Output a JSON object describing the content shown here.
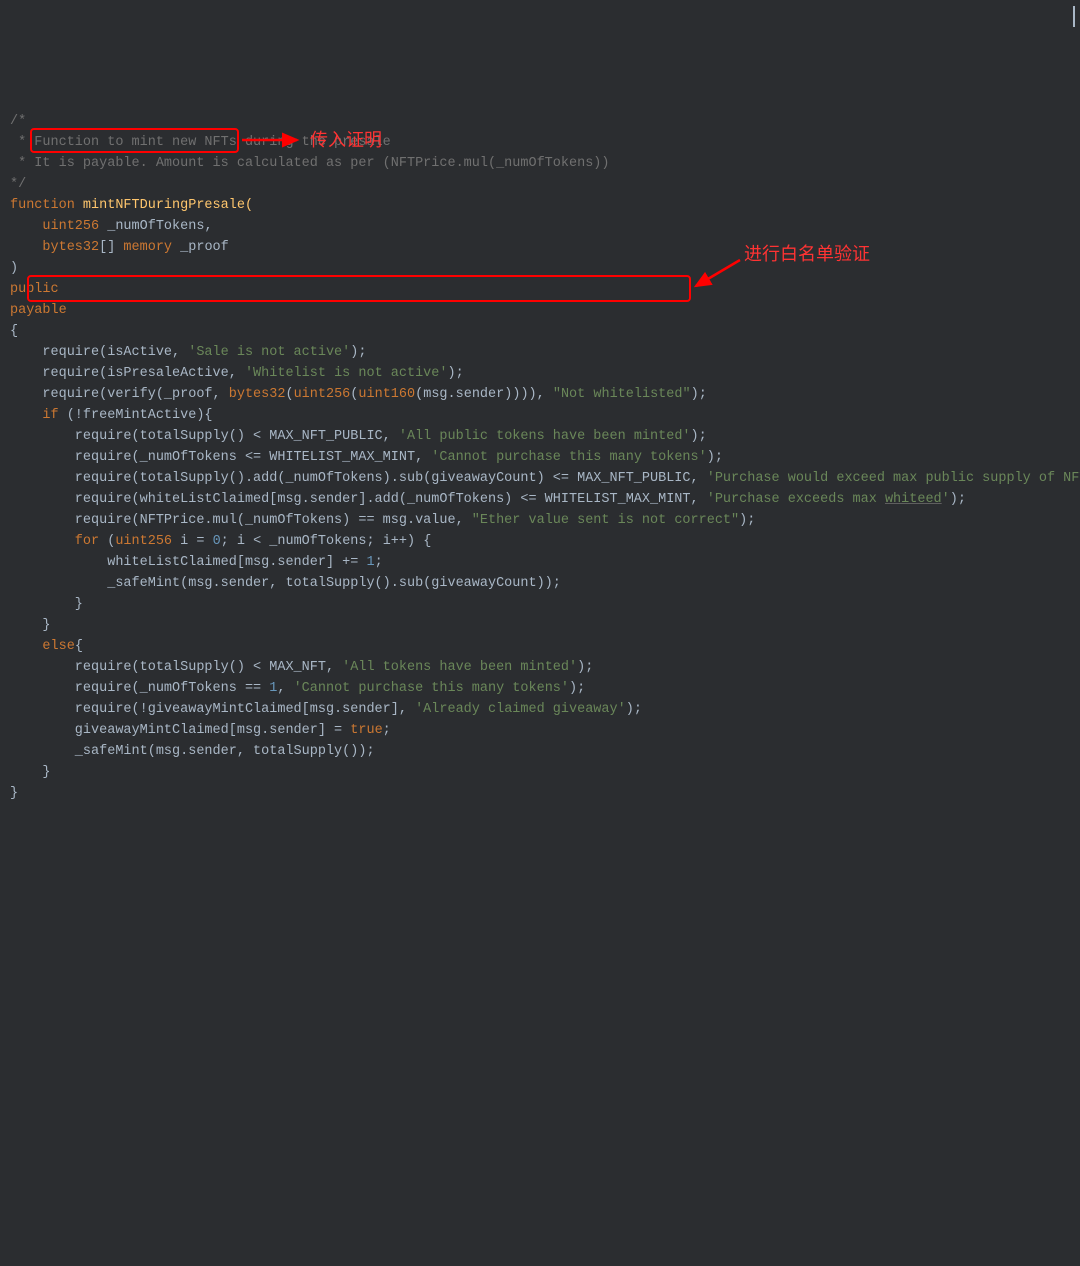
{
  "code": {
    "l00a": "/*",
    "l00b": " * Function to mint new NFTs during the presale",
    "l00c": " * It is payable. Amount is calculated as per (NFTPrice.mul(_numOfTokens))",
    "l00d": "*/",
    "l01_kw_function": "function",
    "l01_name": " mintNFTDuringPresale(",
    "l02_type": "    uint256",
    "l02_ident": " _numOfTokens,",
    "l03_type1": "    bytes32",
    "l03_brackets": "[]",
    "l03_memory": " memory",
    "l03_param": " _proof",
    "l04_paren": ")",
    "l05_public": "public",
    "l06_payable": "payable",
    "l07_brace": "{",
    "l08_a": "    require(isActive, ",
    "l08_s": "'Sale is not active'",
    "l08_b": ");",
    "l09_a": "    require(isPresaleActive, ",
    "l09_s": "'Whitelist is not active'",
    "l09_b": ");",
    "l10_a": "    require(verify(_proof, ",
    "l10_b1": "bytes32",
    "l10_p1": "(",
    "l10_b2": "uint256",
    "l10_p2": "(",
    "l10_b3": "uint160",
    "l10_p3": "(msg.sender)))), ",
    "l10_s": "\"Not whitelisted\"",
    "l10_e": ");",
    "l11_if": "    if",
    "l11_cond": " (!freeMintActive){",
    "l12_a": "        require(totalSupply() < MAX_NFT_PUBLIC, ",
    "l12_s": "'All public tokens have been minted'",
    "l12_b": ");",
    "l13_a": "        require(_numOfTokens <= WHITELIST_MAX_MINT, ",
    "l13_s": "'Cannot purchase this many tokens'",
    "l13_b": ");",
    "l14_a": "        require(totalSupply().add(_numOfTokens).sub(giveawayCount) <= MAX_NFT_PUBLIC, ",
    "l14_s": "'Purchase would exceed max public supply of NFTs'",
    "l14_b": ");",
    "l15_a": "        require(whiteListClaimed[msg.sender].add(_numOfTokens) <= WHITELIST_MAX_MINT, ",
    "l15_s": "'Purchase exceeds max ",
    "l15_w": "whiteed",
    "l15_s2": "'",
    "l15_b": ");",
    "l16_a": "        require(NFTPrice.mul(_numOfTokens) == msg.value, ",
    "l16_s": "\"Ether value sent is not correct\"",
    "l16_b": ");",
    "l17_for": "        for",
    "l17_a": " (",
    "l17_type": "uint256",
    "l17_b": " i = ",
    "l17_num": "0",
    "l17_c": "; i < _numOfTokens; i++) {",
    "l18": "            whiteListClaimed[msg.sender] += ",
    "l18_num": "1",
    "l18_b": ";",
    "l19": "            _safeMint(msg.sender, totalSupply().sub(giveawayCount));",
    "l20": "        }",
    "l21": "    }",
    "l22_else": "    else",
    "l22_brace": "{",
    "l23_a": "        require(totalSupply() < MAX_NFT, ",
    "l23_s": "'All tokens have been minted'",
    "l23_b": ");",
    "l24_a": "        require(_numOfTokens == ",
    "l24_num": "1",
    "l24_b": ", ",
    "l24_s": "'Cannot purchase this many tokens'",
    "l24_c": ");",
    "l25_a": "        require(!giveawayMintClaimed[msg.sender], ",
    "l25_s": "'Already claimed giveaway'",
    "l25_b": ");",
    "l26_a": "        giveawayMintClaimed[msg.sender] = ",
    "l26_true": "true",
    "l26_b": ";",
    "l27": "        _safeMint(msg.sender, totalSupply());",
    "l28": "    }",
    "l29": "}"
  },
  "annotations": {
    "param_label": "传入证明",
    "verify_label": "进行白名单验证"
  }
}
